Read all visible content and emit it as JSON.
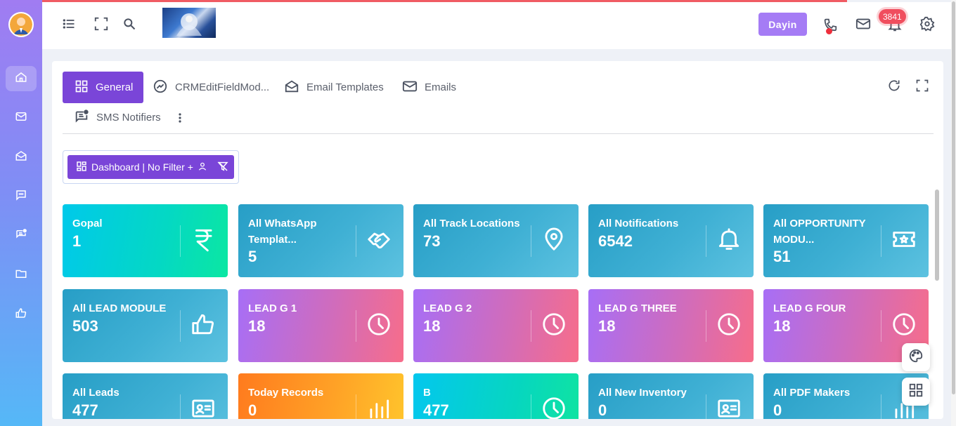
{
  "header": {
    "user_button": "Dayin",
    "notification_count": "3841"
  },
  "sidebar": {
    "items": [
      {
        "name": "home-icon",
        "active": true
      },
      {
        "name": "mail-icon",
        "active": false
      },
      {
        "name": "open-mail-icon",
        "active": false
      },
      {
        "name": "chat-icon",
        "active": false
      },
      {
        "name": "sms-notifier-icon",
        "active": false
      },
      {
        "name": "folder-icon",
        "active": false
      },
      {
        "name": "thumbs-up-icon",
        "active": false
      }
    ]
  },
  "tabs": [
    {
      "label": "General",
      "icon": "grid-icon",
      "active": true
    },
    {
      "label": "CRMEditFieldMod...",
      "icon": "trend-icon",
      "active": false
    },
    {
      "label": "Email Templates",
      "icon": "open-mail-icon",
      "active": false
    },
    {
      "label": "Emails",
      "icon": "mail-icon",
      "active": false
    },
    {
      "label": "SMS Notifiers",
      "icon": "sms-icon",
      "active": false
    }
  ],
  "filter": {
    "label": "Dashboard | No Filter +"
  },
  "cards": [
    {
      "title": "Gopal",
      "value": "1",
      "icon": "rupee-icon",
      "style": "g-teal"
    },
    {
      "title": "All WhatsApp Templat...",
      "value": "5",
      "icon": "handshake-icon",
      "style": "g-blue"
    },
    {
      "title": "All Track Locations",
      "value": "73",
      "icon": "location-pin-icon",
      "style": "g-blue"
    },
    {
      "title": "All Notifications",
      "value": "6542",
      "icon": "bell-icon",
      "style": "g-blue"
    },
    {
      "title": "All OPPORTUNITY MODU...",
      "value": "51",
      "icon": "ticket-star-icon",
      "style": "g-blue"
    },
    {
      "title": "All LEAD MODULE",
      "value": "503",
      "icon": "thumbs-up-icon",
      "style": "g-blue"
    },
    {
      "title": "LEAD G 1",
      "value": "18",
      "icon": "clock-icon",
      "style": "g-pink"
    },
    {
      "title": "LEAD G 2",
      "value": "18",
      "icon": "clock-icon",
      "style": "g-pink"
    },
    {
      "title": "LEAD G THREE",
      "value": "18",
      "icon": "clock-icon",
      "style": "g-pink"
    },
    {
      "title": "LEAD G FOUR",
      "value": "18",
      "icon": "clock-icon",
      "style": "g-pink"
    },
    {
      "title": "All Leads",
      "value": "477",
      "icon": "id-card-icon",
      "style": "g-blue"
    },
    {
      "title": "Today Records",
      "value": "0",
      "icon": "bar-chart-icon",
      "style": "g-orange"
    },
    {
      "title": "B",
      "value": "477",
      "icon": "clock-icon",
      "style": "g-cyan"
    },
    {
      "title": "All New Inventory",
      "value": "0",
      "icon": "id-card-icon",
      "style": "g-blue"
    },
    {
      "title": "All PDF Makers",
      "value": "0",
      "icon": "bar-chart-icon",
      "style": "g-blue"
    }
  ]
}
